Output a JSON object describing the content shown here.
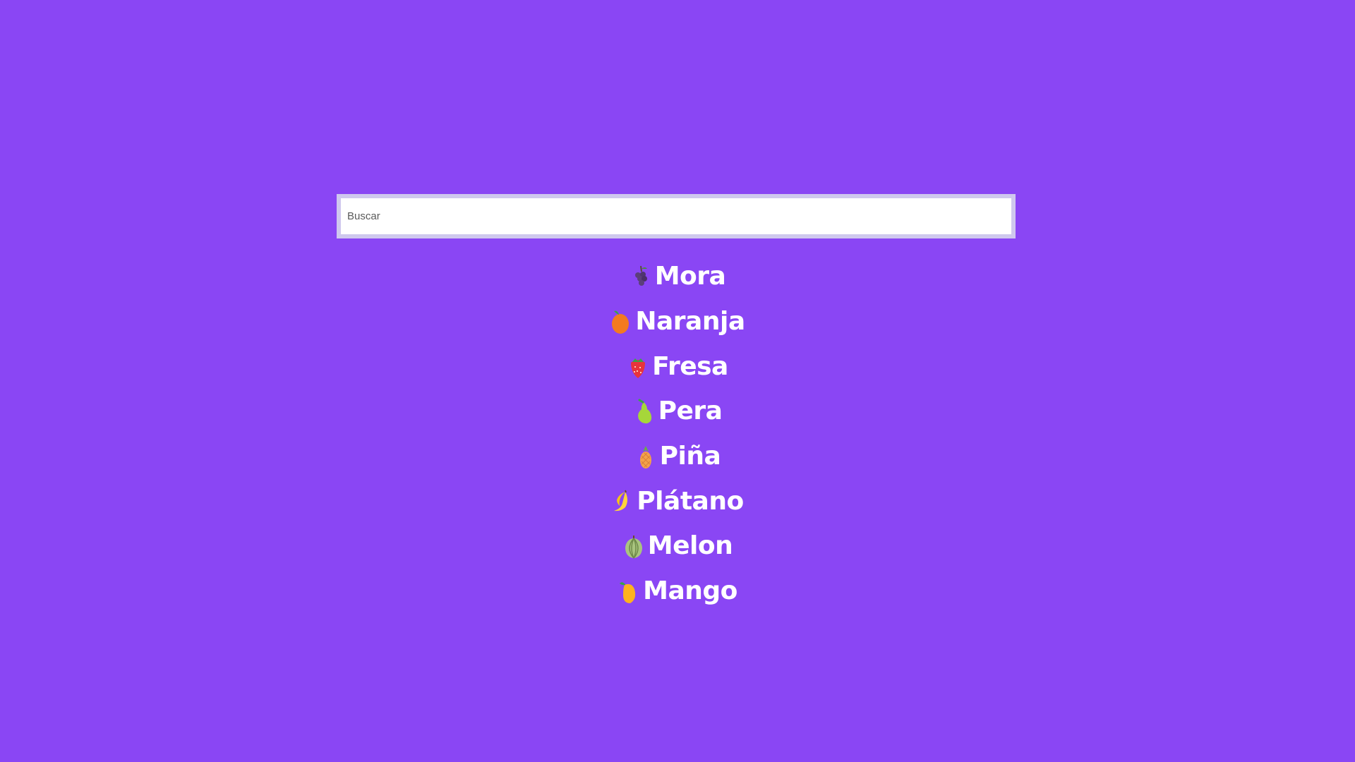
{
  "search": {
    "placeholder": "Buscar",
    "value": ""
  },
  "fruits": [
    {
      "label": "Mora",
      "icon": "blackberry-icon"
    },
    {
      "label": "Naranja",
      "icon": "orange-icon"
    },
    {
      "label": "Fresa",
      "icon": "strawberry-icon"
    },
    {
      "label": "Pera",
      "icon": "pear-icon"
    },
    {
      "label": "Piña",
      "icon": "pineapple-icon"
    },
    {
      "label": "Plátano",
      "icon": "banana-icon"
    },
    {
      "label": "Melon",
      "icon": "melon-icon"
    },
    {
      "label": "Mango",
      "icon": "mango-icon"
    }
  ],
  "colors": {
    "background": "#8a46f4",
    "search_border": "#cfc8ee",
    "text": "#ffffff"
  }
}
